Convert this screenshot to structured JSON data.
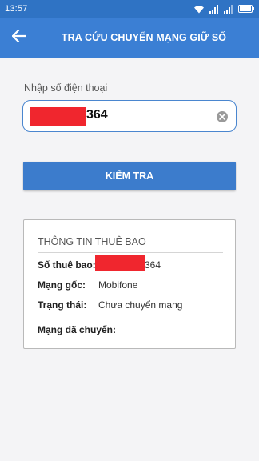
{
  "status_bar": {
    "time": "13:57",
    "icons": [
      "wifi-icon",
      "signal-icon",
      "signal-icon",
      "battery-icon"
    ]
  },
  "app_bar": {
    "title": "TRA CỨU CHUYỂN MẠNG GIỮ SỐ",
    "back_icon": "arrow-left-icon"
  },
  "form": {
    "phone_label": "Nhập số điện thoại",
    "phone_value_visible": "364",
    "clear_icon": "clear-circle-icon",
    "submit_label": "KIỂM TRA"
  },
  "colors": {
    "primary": "#3b7fd4",
    "status_bar": "#2f73c4",
    "redaction": "#f0262e"
  },
  "subscriber_info": {
    "title": "THÔNG TIN THUÊ BAO",
    "rows": [
      {
        "label": "Số thuê bao:",
        "value": "364"
      },
      {
        "label": "Mạng gốc:",
        "value": "Mobifone"
      },
      {
        "label": "Trạng thái:",
        "value": "Chưa chuyển mạng"
      },
      {
        "label": "Mạng đã chuyển:",
        "value": ""
      }
    ]
  }
}
